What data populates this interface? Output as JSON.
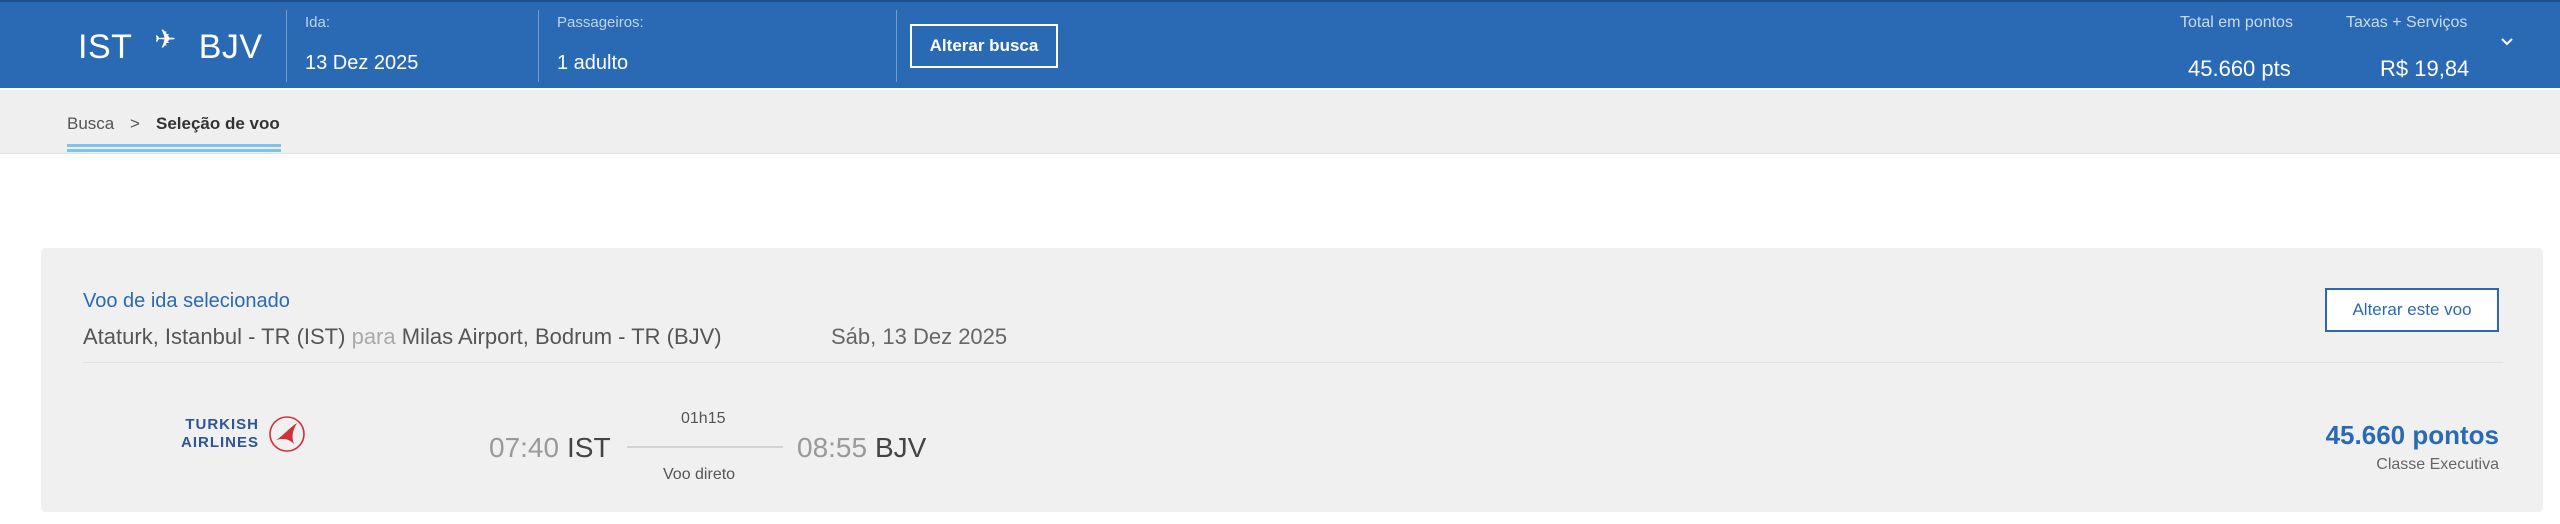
{
  "header": {
    "origin": "IST",
    "destination": "BJV",
    "departure_label": "Ida:",
    "departure_value": "13 Dez 2025",
    "passengers_label": "Passageiros:",
    "passengers_value": "1 adulto",
    "alter_search_label": "Alterar busca",
    "total_points_label": "Total em pontos",
    "total_points_value": "45.660 pts",
    "taxes_label": "Taxas + Serviços",
    "taxes_value": "R$ 19,84"
  },
  "breadcrumb": {
    "items": [
      "Busca",
      "Seleção de voo"
    ],
    "separator": ">"
  },
  "selected_flight": {
    "title": "Voo de ida selecionado",
    "origin_full": "Ataturk, Istanbul - TR (IST)",
    "connector": "para",
    "destination_full": "Milas Airport, Bodrum - TR (BJV)",
    "date": "Sáb, 13 Dez 2025",
    "alter_flight_label": "Alterar este voo",
    "airline_line1": "TURKISH",
    "airline_line2": "AIRLINES",
    "departure_time": "07:40",
    "departure_code": "IST",
    "duration": "01h15",
    "stops": "Voo direto",
    "arrival_time": "08:55",
    "arrival_code": "BJV",
    "points": "45.660 pontos",
    "cabin_class": "Classe Executiva"
  },
  "colors": {
    "header_bg": "#2a6ab5",
    "accent": "#2a6ab5",
    "breadcrumb_underline": "#7fc3e8",
    "airline_red": "#d0303a"
  }
}
